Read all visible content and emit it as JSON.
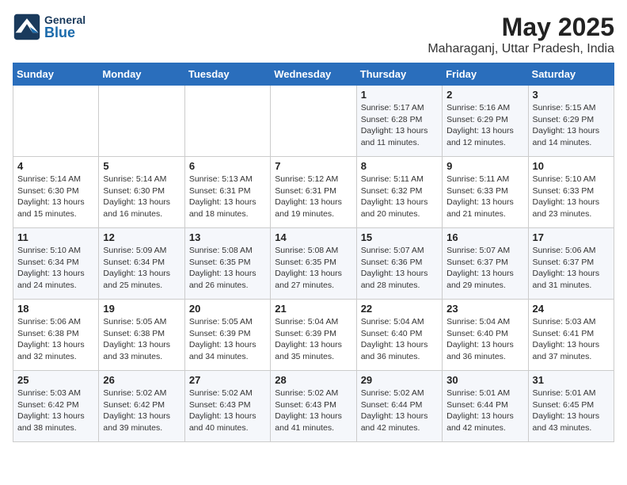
{
  "header": {
    "logo": {
      "general": "General",
      "blue": "Blue"
    },
    "title": "May 2025",
    "subtitle": "Maharaganj, Uttar Pradesh, India"
  },
  "weekdays": [
    "Sunday",
    "Monday",
    "Tuesday",
    "Wednesday",
    "Thursday",
    "Friday",
    "Saturday"
  ],
  "weeks": [
    [
      {
        "day": "",
        "info": ""
      },
      {
        "day": "",
        "info": ""
      },
      {
        "day": "",
        "info": ""
      },
      {
        "day": "",
        "info": ""
      },
      {
        "day": "1",
        "info": "Sunrise: 5:17 AM\nSunset: 6:28 PM\nDaylight: 13 hours\nand 11 minutes."
      },
      {
        "day": "2",
        "info": "Sunrise: 5:16 AM\nSunset: 6:29 PM\nDaylight: 13 hours\nand 12 minutes."
      },
      {
        "day": "3",
        "info": "Sunrise: 5:15 AM\nSunset: 6:29 PM\nDaylight: 13 hours\nand 14 minutes."
      }
    ],
    [
      {
        "day": "4",
        "info": "Sunrise: 5:14 AM\nSunset: 6:30 PM\nDaylight: 13 hours\nand 15 minutes."
      },
      {
        "day": "5",
        "info": "Sunrise: 5:14 AM\nSunset: 6:30 PM\nDaylight: 13 hours\nand 16 minutes."
      },
      {
        "day": "6",
        "info": "Sunrise: 5:13 AM\nSunset: 6:31 PM\nDaylight: 13 hours\nand 18 minutes."
      },
      {
        "day": "7",
        "info": "Sunrise: 5:12 AM\nSunset: 6:31 PM\nDaylight: 13 hours\nand 19 minutes."
      },
      {
        "day": "8",
        "info": "Sunrise: 5:11 AM\nSunset: 6:32 PM\nDaylight: 13 hours\nand 20 minutes."
      },
      {
        "day": "9",
        "info": "Sunrise: 5:11 AM\nSunset: 6:33 PM\nDaylight: 13 hours\nand 21 minutes."
      },
      {
        "day": "10",
        "info": "Sunrise: 5:10 AM\nSunset: 6:33 PM\nDaylight: 13 hours\nand 23 minutes."
      }
    ],
    [
      {
        "day": "11",
        "info": "Sunrise: 5:10 AM\nSunset: 6:34 PM\nDaylight: 13 hours\nand 24 minutes."
      },
      {
        "day": "12",
        "info": "Sunrise: 5:09 AM\nSunset: 6:34 PM\nDaylight: 13 hours\nand 25 minutes."
      },
      {
        "day": "13",
        "info": "Sunrise: 5:08 AM\nSunset: 6:35 PM\nDaylight: 13 hours\nand 26 minutes."
      },
      {
        "day": "14",
        "info": "Sunrise: 5:08 AM\nSunset: 6:35 PM\nDaylight: 13 hours\nand 27 minutes."
      },
      {
        "day": "15",
        "info": "Sunrise: 5:07 AM\nSunset: 6:36 PM\nDaylight: 13 hours\nand 28 minutes."
      },
      {
        "day": "16",
        "info": "Sunrise: 5:07 AM\nSunset: 6:37 PM\nDaylight: 13 hours\nand 29 minutes."
      },
      {
        "day": "17",
        "info": "Sunrise: 5:06 AM\nSunset: 6:37 PM\nDaylight: 13 hours\nand 31 minutes."
      }
    ],
    [
      {
        "day": "18",
        "info": "Sunrise: 5:06 AM\nSunset: 6:38 PM\nDaylight: 13 hours\nand 32 minutes."
      },
      {
        "day": "19",
        "info": "Sunrise: 5:05 AM\nSunset: 6:38 PM\nDaylight: 13 hours\nand 33 minutes."
      },
      {
        "day": "20",
        "info": "Sunrise: 5:05 AM\nSunset: 6:39 PM\nDaylight: 13 hours\nand 34 minutes."
      },
      {
        "day": "21",
        "info": "Sunrise: 5:04 AM\nSunset: 6:39 PM\nDaylight: 13 hours\nand 35 minutes."
      },
      {
        "day": "22",
        "info": "Sunrise: 5:04 AM\nSunset: 6:40 PM\nDaylight: 13 hours\nand 36 minutes."
      },
      {
        "day": "23",
        "info": "Sunrise: 5:04 AM\nSunset: 6:40 PM\nDaylight: 13 hours\nand 36 minutes."
      },
      {
        "day": "24",
        "info": "Sunrise: 5:03 AM\nSunset: 6:41 PM\nDaylight: 13 hours\nand 37 minutes."
      }
    ],
    [
      {
        "day": "25",
        "info": "Sunrise: 5:03 AM\nSunset: 6:42 PM\nDaylight: 13 hours\nand 38 minutes."
      },
      {
        "day": "26",
        "info": "Sunrise: 5:02 AM\nSunset: 6:42 PM\nDaylight: 13 hours\nand 39 minutes."
      },
      {
        "day": "27",
        "info": "Sunrise: 5:02 AM\nSunset: 6:43 PM\nDaylight: 13 hours\nand 40 minutes."
      },
      {
        "day": "28",
        "info": "Sunrise: 5:02 AM\nSunset: 6:43 PM\nDaylight: 13 hours\nand 41 minutes."
      },
      {
        "day": "29",
        "info": "Sunrise: 5:02 AM\nSunset: 6:44 PM\nDaylight: 13 hours\nand 42 minutes."
      },
      {
        "day": "30",
        "info": "Sunrise: 5:01 AM\nSunset: 6:44 PM\nDaylight: 13 hours\nand 42 minutes."
      },
      {
        "day": "31",
        "info": "Sunrise: 5:01 AM\nSunset: 6:45 PM\nDaylight: 13 hours\nand 43 minutes."
      }
    ]
  ]
}
